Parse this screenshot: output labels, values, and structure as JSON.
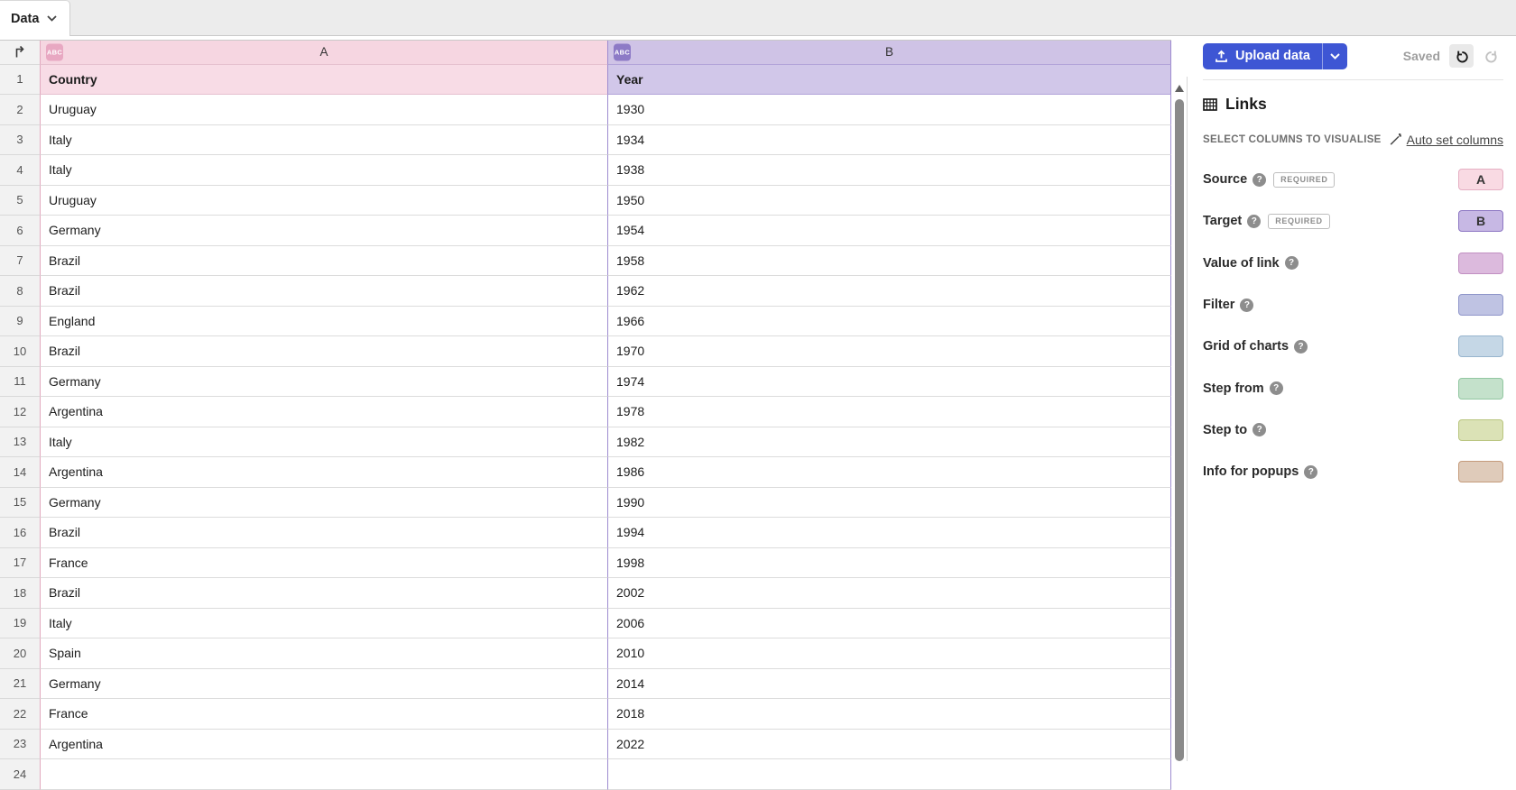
{
  "tab_bar": {
    "tabs": [
      {
        "label": "Data"
      }
    ]
  },
  "sheet": {
    "corner_icon": "row-column-arrow-icon",
    "columns": [
      {
        "letter": "A",
        "type_badge": "ABC",
        "header_bg": "#f6d6e1",
        "cell_bg": "#f8dce6",
        "badge_bg": "#e8a8c2",
        "border": "#e2a9bf",
        "line": "#e6c0cf"
      },
      {
        "letter": "B",
        "type_badge": "ABC",
        "header_bg": "#cfc3e6",
        "cell_bg": "#d1c7e9",
        "badge_bg": "#8d7ac6",
        "border": "#9d8bd0",
        "line": "#b2a3d9"
      }
    ],
    "rows": [
      {
        "n": "1",
        "a": "Country",
        "b": "Year"
      },
      {
        "n": "2",
        "a": "Uruguay",
        "b": "1930"
      },
      {
        "n": "3",
        "a": "Italy",
        "b": "1934"
      },
      {
        "n": "4",
        "a": "Italy",
        "b": "1938"
      },
      {
        "n": "5",
        "a": "Uruguay",
        "b": "1950"
      },
      {
        "n": "6",
        "a": "Germany",
        "b": "1954"
      },
      {
        "n": "7",
        "a": "Brazil",
        "b": "1958"
      },
      {
        "n": "8",
        "a": "Brazil",
        "b": "1962"
      },
      {
        "n": "9",
        "a": "England",
        "b": "1966"
      },
      {
        "n": "10",
        "a": "Brazil",
        "b": "1970"
      },
      {
        "n": "11",
        "a": "Germany",
        "b": "1974"
      },
      {
        "n": "12",
        "a": "Argentina",
        "b": "1978"
      },
      {
        "n": "13",
        "a": "Italy",
        "b": "1982"
      },
      {
        "n": "14",
        "a": "Argentina",
        "b": "1986"
      },
      {
        "n": "15",
        "a": "Germany",
        "b": "1990"
      },
      {
        "n": "16",
        "a": "Brazil",
        "b": "1994"
      },
      {
        "n": "17",
        "a": "France",
        "b": "1998"
      },
      {
        "n": "18",
        "a": "Brazil",
        "b": "2002"
      },
      {
        "n": "19",
        "a": "Italy",
        "b": "2006"
      },
      {
        "n": "20",
        "a": "Spain",
        "b": "2010"
      },
      {
        "n": "21",
        "a": "Germany",
        "b": "2014"
      },
      {
        "n": "22",
        "a": "France",
        "b": "2018"
      },
      {
        "n": "23",
        "a": "Argentina",
        "b": "2022"
      },
      {
        "n": "24",
        "a": "",
        "b": ""
      }
    ]
  },
  "toolbar": {
    "upload_label": "Upload data",
    "upload_icon": "upload-icon",
    "saved_label": "Saved",
    "undo_icon": "undo-icon",
    "redo_icon": "redo-icon"
  },
  "links_panel": {
    "title": "Links",
    "title_icon": "table-grid-icon",
    "select_label": "SELECT COLUMNS TO VISUALISE",
    "auto_set_label": "Auto set columns",
    "auto_set_icon": "magic-wand-icon",
    "required_label": "REQUIRED",
    "help_glyph": "?",
    "bindings": [
      {
        "label": "Source",
        "required": true,
        "value": "A",
        "bg": "#f9dae3",
        "border": "#e5afc3"
      },
      {
        "label": "Target",
        "required": true,
        "value": "B",
        "bg": "#c7b8e4",
        "border": "#8d77c3"
      },
      {
        "label": "Value of link",
        "required": false,
        "value": "",
        "bg": "#dcbadd",
        "border": "#c18fc2"
      },
      {
        "label": "Filter",
        "required": false,
        "value": "",
        "bg": "#bfc3e3",
        "border": "#8f96ca"
      },
      {
        "label": "Grid of charts",
        "required": false,
        "value": "",
        "bg": "#c5d7e6",
        "border": "#97b4cd"
      },
      {
        "label": "Step from",
        "required": false,
        "value": "",
        "bg": "#c4e1cb",
        "border": "#92c7a1"
      },
      {
        "label": "Step to",
        "required": false,
        "value": "",
        "bg": "#dbe2b6",
        "border": "#b9c57f"
      },
      {
        "label": "Info for popups",
        "required": false,
        "value": "",
        "bg": "#dfcbba",
        "border": "#c59b7b"
      }
    ]
  },
  "colors": {
    "accent_blue": "#3e56d4"
  }
}
